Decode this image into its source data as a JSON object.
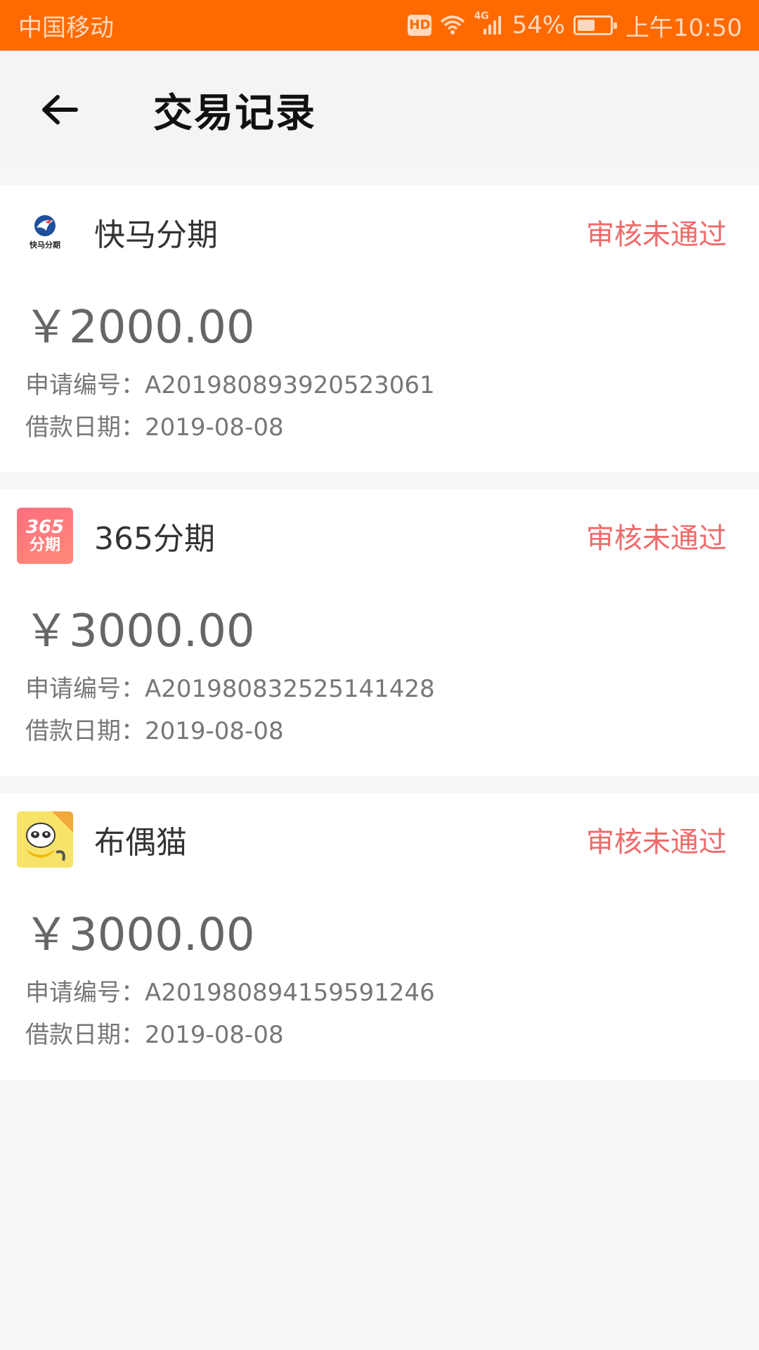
{
  "status_bar": {
    "carrier": "中国移动",
    "hd": "HD",
    "network": "4G",
    "battery": "54%",
    "battery_level": 0.54,
    "time": "上午10:50"
  },
  "header": {
    "title": "交易记录",
    "back_icon": "arrow-left-icon"
  },
  "records": [
    {
      "merchant": "快马分期",
      "logo_text": "快马分期",
      "status": "审核未通过",
      "amount": "￥2000.00",
      "app_no_label": "申请编号：",
      "app_no": "A201980893920523061",
      "date_label": "借款日期：",
      "date": "2019-08-08"
    },
    {
      "merchant": "365分期",
      "logo_text_1": "365",
      "logo_text_2": "分期",
      "status": "审核未通过",
      "amount": "￥3000.00",
      "app_no_label": "申请编号：",
      "app_no": "A201980832525141428",
      "date_label": "借款日期：",
      "date": "2019-08-08"
    },
    {
      "merchant": "布偶猫",
      "status": "审核未通过",
      "amount": "￥3000.00",
      "app_no_label": "申请编号：",
      "app_no": "A201980894159591246",
      "date_label": "借款日期：",
      "date": "2019-08-08"
    }
  ],
  "colors": {
    "status_bar": "#ff6a00",
    "status_text": "#ee6b6b",
    "amount_text": "#666666"
  }
}
